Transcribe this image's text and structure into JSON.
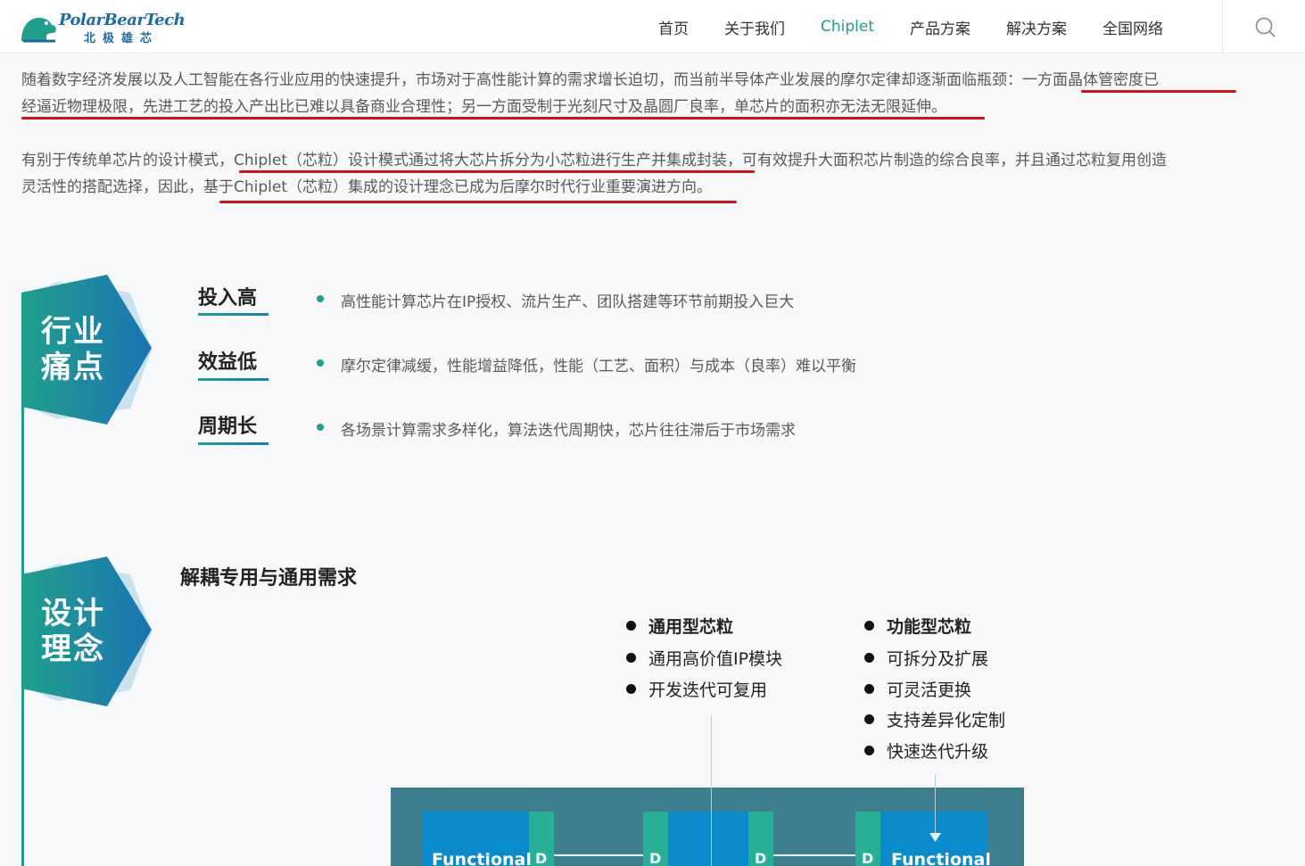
{
  "header": {
    "logo_name": "PolarBearTech",
    "logo_cn": "北极雄芯",
    "nav": [
      "首页",
      "关于我们",
      "Chiplet",
      "产品方案",
      "解决方案",
      "全国网络"
    ],
    "active_nav": "Chiplet",
    "search_icon": "search-icon"
  },
  "intro": {
    "p1_line1": "随着数字经济发展以及人工智能在各行业应用的快速提升，市场对于高性能计算的需求增长迫切，而当前半导体产业发展的摩尔定律却逐渐面临瓶颈：一方面晶体管密度已",
    "p1_line2": "经逼近物理极限，先进工艺的投入产出比已难以具备商业合理性；另一方面受制于光刻尺寸及晶圆厂良率，单芯片的面积亦无法无限延伸。",
    "p2_line1": "有别于传统单芯片的设计模式，Chiplet（芯粒）设计模式通过将大芯片拆分为小芯粒进行生产并集成封装，可有效提升大面积芯片制造的综合良率，并且通过芯粒复用创造",
    "p2_line2": "灵活性的搭配选择，因此，基于Chiplet（芯粒）集成的设计理念已成为后摩尔时代行业重要演进方向。"
  },
  "pain_points": {
    "badge_line1": "行业",
    "badge_line2": "痛点",
    "items": [
      {
        "title": "投入高",
        "desc": "高性能计算芯片在IP授权、流片生产、团队搭建等环节前期投入巨大"
      },
      {
        "title": "效益低",
        "desc": "摩尔定律减缓，性能增益降低，性能（工艺、面积）与成本（良率）难以平衡"
      },
      {
        "title": "周期长",
        "desc": "各场景计算需求多样化，算法迭代周期快，芯片往往滞后于市场需求"
      }
    ]
  },
  "design": {
    "badge_line1": "设计",
    "badge_line2": "理念",
    "title": "解耦专用与通用需求",
    "general": {
      "heading": "通用型芯粒",
      "items": [
        "通用高价值IP模块",
        "开发迭代可复用"
      ]
    },
    "functional": {
      "heading": "功能型芯粒",
      "items": [
        "可拆分及扩展",
        "可灵活更换",
        "支持差异化定制",
        "快速迭代升级"
      ]
    },
    "diagram": {
      "left_label": "Functional",
      "right_label": "Functional",
      "d_label": "D"
    }
  },
  "colors": {
    "accent": "#1f9e8a",
    "brand": "#1a6da3",
    "underline": "#d1121b"
  }
}
